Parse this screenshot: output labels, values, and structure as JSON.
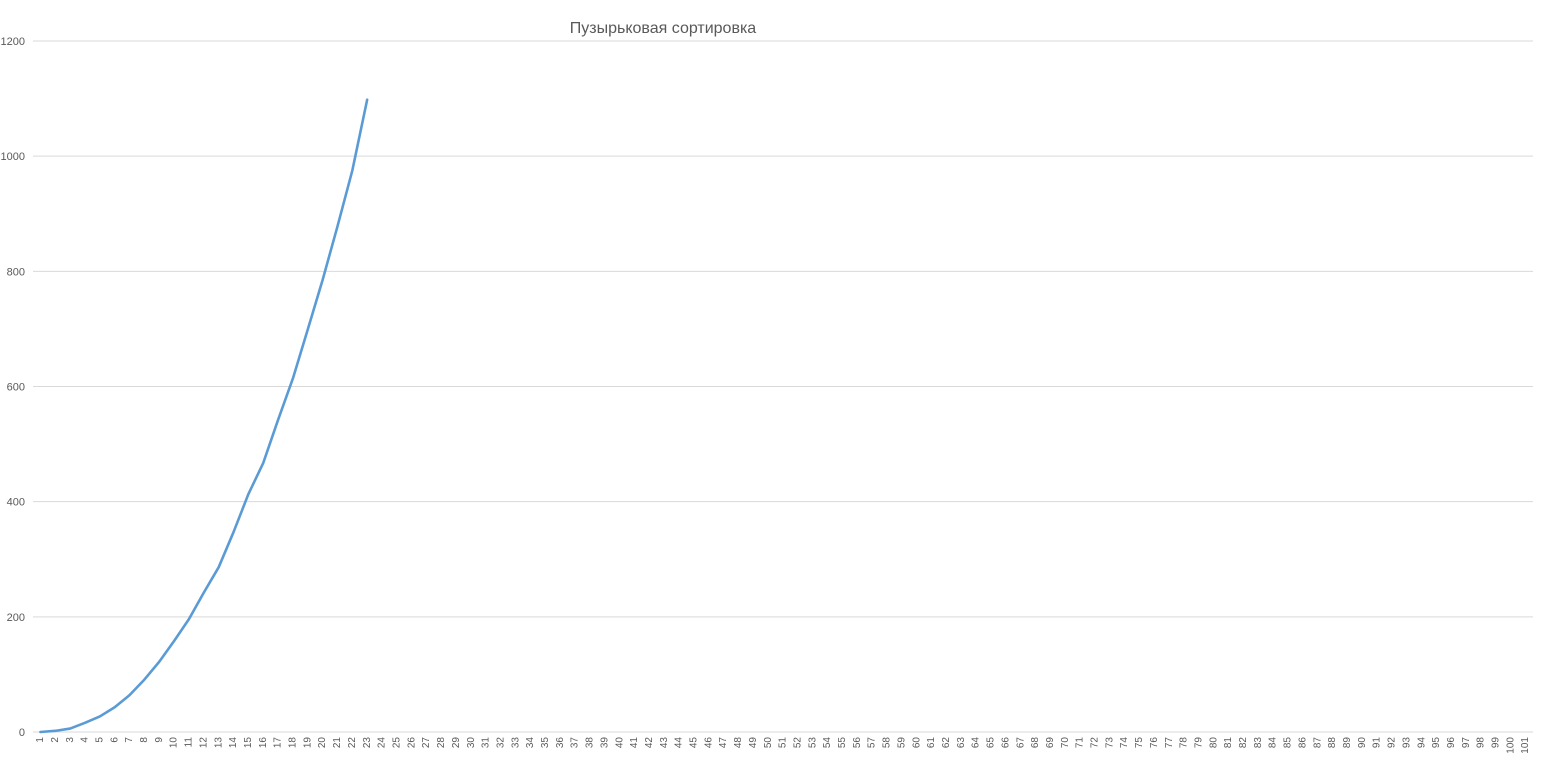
{
  "chart_data": {
    "type": "line",
    "title": "Пузырьковая сортировка",
    "xlabel": "",
    "ylabel": "",
    "categories": [
      "1",
      "2",
      "3",
      "4",
      "5",
      "6",
      "7",
      "8",
      "9",
      "10",
      "11",
      "12",
      "13",
      "14",
      "15",
      "16",
      "17",
      "18",
      "19",
      "20",
      "21",
      "22",
      "23",
      "24",
      "25",
      "26",
      "27",
      "28",
      "29",
      "30",
      "31",
      "32",
      "33",
      "34",
      "35",
      "36",
      "37",
      "38",
      "39",
      "40",
      "41",
      "42",
      "43",
      "44",
      "45",
      "46",
      "47",
      "48",
      "49",
      "50",
      "51",
      "52",
      "53",
      "54",
      "55",
      "56",
      "57",
      "58",
      "59",
      "60",
      "61",
      "62",
      "63",
      "64",
      "65",
      "66",
      "67",
      "68",
      "69",
      "70",
      "71",
      "72",
      "73",
      "74",
      "75",
      "76",
      "77",
      "78",
      "79",
      "80",
      "81",
      "82",
      "83",
      "84",
      "85",
      "86",
      "87",
      "88",
      "89",
      "90",
      "91",
      "92",
      "93",
      "94",
      "95",
      "96",
      "97",
      "98",
      "99",
      "100",
      "101"
    ],
    "series": [
      {
        "values": [
          0,
          2,
          6,
          16,
          27,
          43,
          64,
          91,
          122,
          158,
          196,
          242,
          286,
          347,
          413,
          467,
          542,
          614,
          699,
          785,
          878,
          975,
          1098
        ]
      }
    ],
    "ylim": [
      0,
      1200
    ],
    "yticks": [
      "0",
      "200",
      "400",
      "600",
      "800",
      "1000",
      "1200"
    ],
    "grid": true,
    "legend": "none",
    "colors": {
      "series": "#5b9bd5",
      "grid": "#d9d9d9",
      "text": "#595959"
    }
  }
}
